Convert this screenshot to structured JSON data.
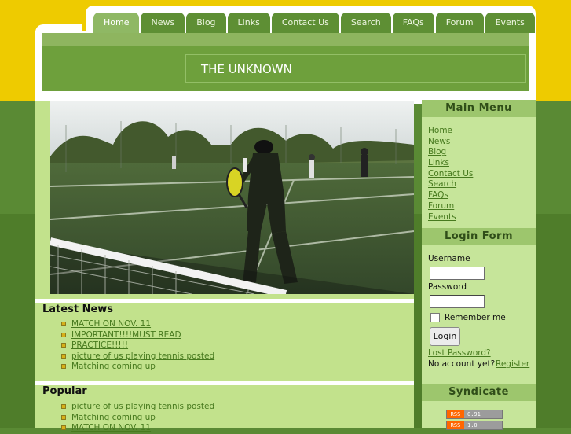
{
  "nav": {
    "tabs": [
      {
        "label": "Home"
      },
      {
        "label": "News"
      },
      {
        "label": "Blog"
      },
      {
        "label": "Links"
      },
      {
        "label": "Contact Us"
      },
      {
        "label": "Search"
      },
      {
        "label": "FAQs"
      },
      {
        "label": "Forum"
      },
      {
        "label": "Events"
      }
    ],
    "active": "Home"
  },
  "header": {
    "site_title": "THE UNKNOWN"
  },
  "latest_news": {
    "title": "Latest News",
    "items": [
      "MATCH ON NOV. 11",
      "IMPORTANT!!!!MUST READ",
      "PRACTICE!!!!!",
      "picture of us playing tennis posted",
      "Matching coming up"
    ]
  },
  "popular": {
    "title": "Popular",
    "items": [
      "picture of us playing tennis posted",
      "Matching coming up",
      "MATCH ON NOV. 11"
    ]
  },
  "main_menu": {
    "title": "Main Menu",
    "items": [
      "Home",
      "News",
      "Blog",
      "Links",
      "Contact Us",
      "Search",
      "FAQs",
      "Forum",
      "Events"
    ]
  },
  "login": {
    "title": "Login Form",
    "username_label": "Username",
    "password_label": "Password",
    "remember_label": "Remember me",
    "button": "Login",
    "lost_password": "Lost Password?",
    "no_account": "No account yet?",
    "register": "Register"
  },
  "syndicate": {
    "title": "Syndicate",
    "feeds": [
      {
        "badge": "RSS",
        "version": "0.91"
      },
      {
        "badge": "RSS",
        "version": "1.0"
      }
    ]
  },
  "colors": {
    "yellow": "#eecb00",
    "green_dark": "#5a8a34",
    "tab": "#5e8f34",
    "tab_active": "#8fb864",
    "content": "#c2e28c",
    "link": "#477a1e"
  }
}
